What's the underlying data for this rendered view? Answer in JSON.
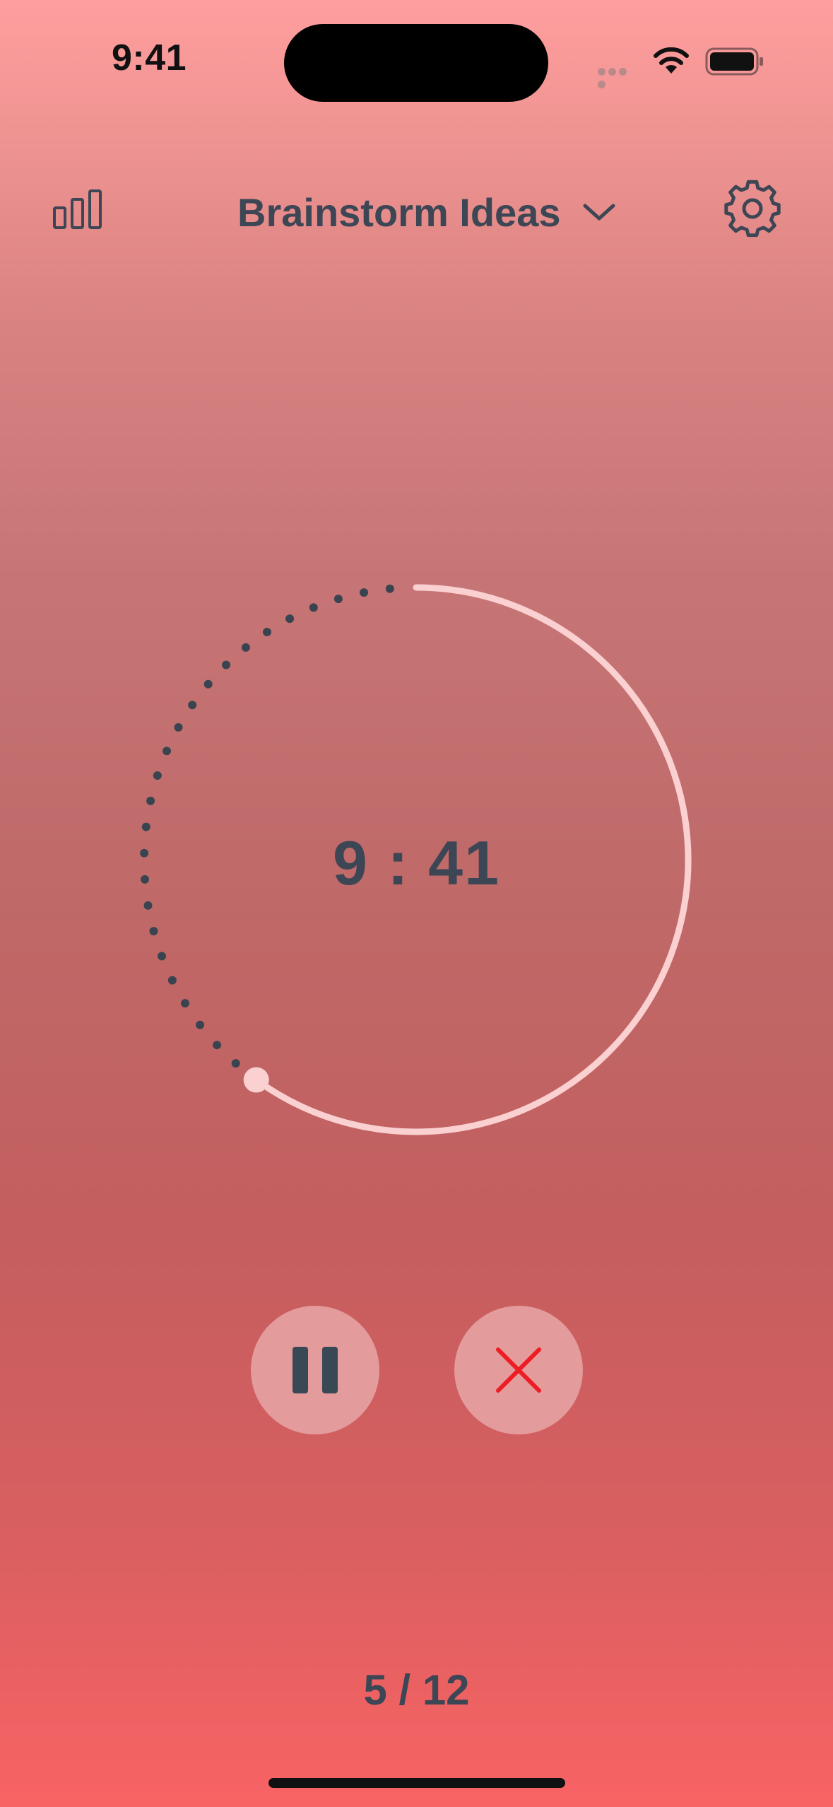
{
  "status_bar": {
    "time": "9:41"
  },
  "header": {
    "stats_icon": "bar-chart-icon",
    "title": "Brainstorm Ideas",
    "dropdown_icon": "chevron-down-icon",
    "settings_icon": "gear-icon"
  },
  "timer": {
    "time_display": "9 : 41",
    "progress_fraction": 0.6,
    "remaining_style": "dotted",
    "colors": {
      "progress": "#fbd0d0",
      "dots": "#3a4450"
    }
  },
  "controls": {
    "pause_icon": "pause-icon",
    "close_icon": "close-icon",
    "close_color": "#ee1c24"
  },
  "footer": {
    "session_counter": "5 / 12"
  }
}
